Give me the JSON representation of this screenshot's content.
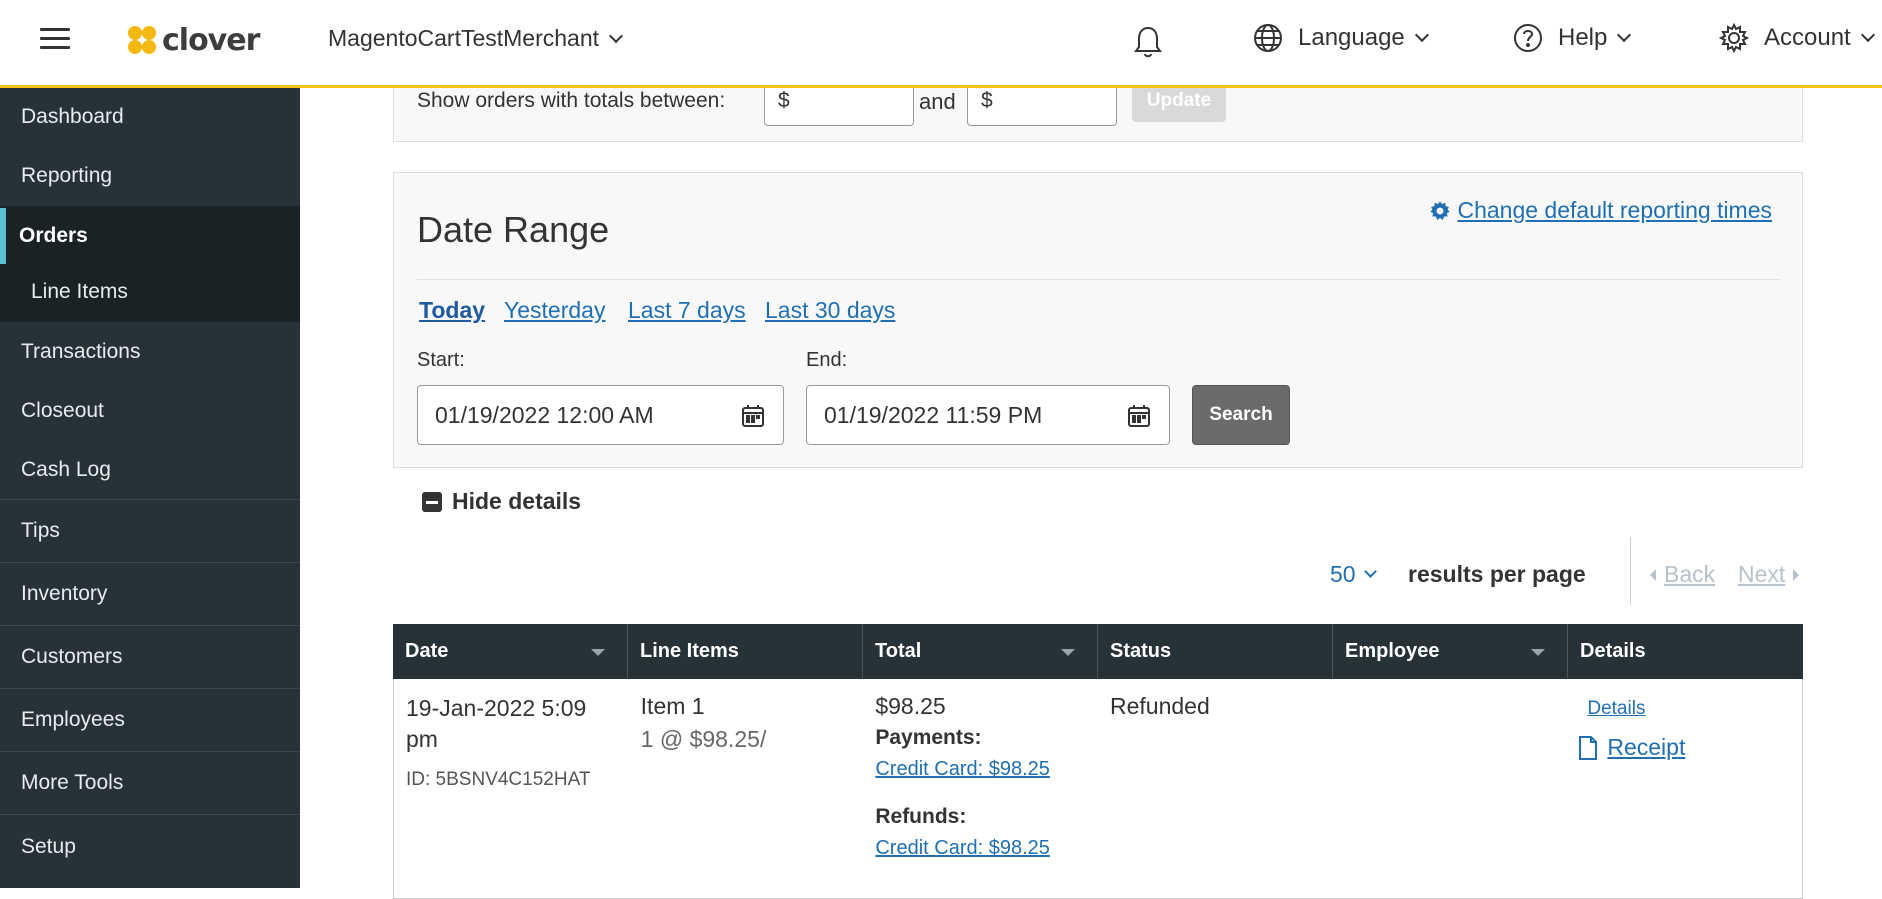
{
  "header": {
    "logo_text": "clover",
    "merchant": "MagentoCartTestMerchant",
    "language_label": "Language",
    "help_label": "Help",
    "account_label": "Account"
  },
  "sidebar": {
    "items": [
      {
        "label": "Dashboard"
      },
      {
        "label": "Reporting"
      },
      {
        "label": "Orders"
      },
      {
        "label": "Line Items"
      },
      {
        "label": "Transactions"
      },
      {
        "label": "Closeout"
      },
      {
        "label": "Cash Log"
      },
      {
        "label": "Tips"
      },
      {
        "label": "Inventory"
      },
      {
        "label": "Customers"
      },
      {
        "label": "Employees"
      },
      {
        "label": "More Tools"
      },
      {
        "label": "Setup"
      }
    ],
    "active_item": "Orders"
  },
  "filters": {
    "totals_label": "Show orders with totals between:",
    "min_value": "$",
    "and_label": "and",
    "max_value": "$",
    "update_label": "Update"
  },
  "date_range": {
    "title": "Date Range",
    "change_link": "Change default reporting times",
    "quick_ranges": [
      "Today",
      "Yesterday",
      "Last 7 days",
      "Last 30 days"
    ],
    "active_range": "Today",
    "start_label": "Start:",
    "start_value": "01/19/2022 12:00 AM",
    "end_label": "End:",
    "end_value": "01/19/2022 11:59 PM",
    "search_label": "Search"
  },
  "details_toggle": "Hide details",
  "pager": {
    "per_page": "50",
    "per_page_label": "results per page",
    "back_label": "Back",
    "next_label": "Next"
  },
  "table": {
    "columns": [
      "Date",
      "Line Items",
      "Total",
      "Status",
      "Employee",
      "Details"
    ],
    "rows": [
      {
        "date": "19-Jan-2022 5:09 pm",
        "id": "ID: 5BSNV4C152HAT",
        "item_name": "Item 1",
        "item_qty": "1 @ $98.25/",
        "total": "$98.25",
        "payments_label": "Payments:",
        "payment": "Credit Card: $98.25",
        "refunds_label": "Refunds:",
        "refund": "Credit Card: $98.25",
        "status": "Refunded",
        "employee": "",
        "details_link": "Details",
        "receipt_link": "Receipt"
      }
    ]
  },
  "colors": {
    "sidebar_bg": "#263238",
    "accent_yellow": "#f2c512",
    "link_blue": "#1f6fb2",
    "active_indicator": "#5bc0d1"
  }
}
